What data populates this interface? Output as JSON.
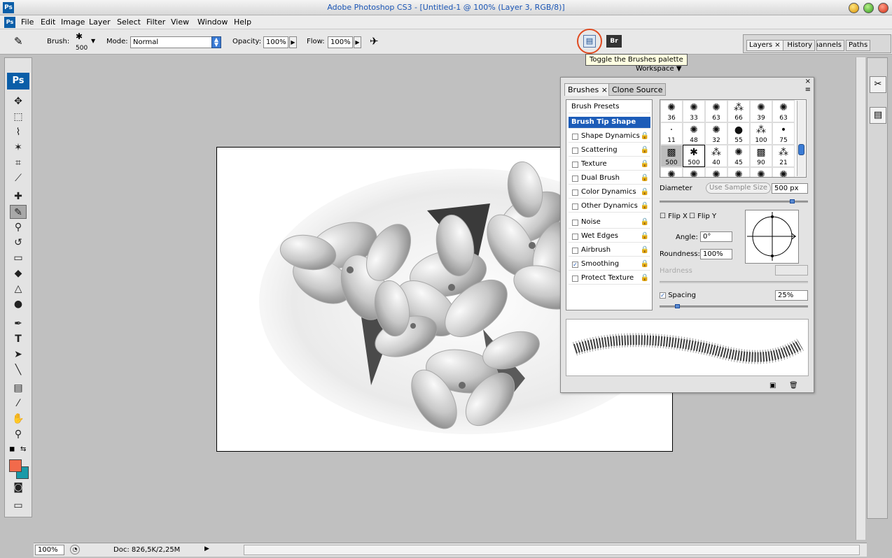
{
  "window": {
    "title": "Adobe Photoshop CS3 - [Untitled-1 @ 100% (Layer 3, RGB/8)]",
    "app_logo": "Ps"
  },
  "menu": [
    "File",
    "Edit",
    "Image",
    "Layer",
    "Select",
    "Filter",
    "View",
    "Window",
    "Help"
  ],
  "options": {
    "brush_label": "Brush:",
    "brush_size": "500",
    "mode_label": "Mode:",
    "mode_value": "Normal",
    "opacity_label": "Opacity:",
    "opacity_value": "100%",
    "flow_label": "Flow:",
    "flow_value": "100%",
    "workspace_label": "Workspace",
    "tooltip": "Toggle the Brushes palette"
  },
  "layers_dock": {
    "tabs": [
      "Layers",
      "History",
      "Channels",
      "Paths"
    ]
  },
  "toolbox": {
    "logo": "Ps",
    "fg_color": "#f26a4b",
    "bg_color": "#1a9aa8"
  },
  "brushes_palette": {
    "tabs": [
      "Brushes",
      "Clone Source"
    ],
    "header": "Brush Presets",
    "items": [
      {
        "label": "Brush Tip Shape",
        "checked": null
      },
      {
        "label": "Shape Dynamics",
        "checked": false
      },
      {
        "label": "Scattering",
        "checked": false
      },
      {
        "label": "Texture",
        "checked": false
      },
      {
        "label": "Dual Brush",
        "checked": false
      },
      {
        "label": "Color Dynamics",
        "checked": false
      },
      {
        "label": "Other Dynamics",
        "checked": false
      },
      {
        "label": "Noise",
        "checked": false
      },
      {
        "label": "Wet Edges",
        "checked": false
      },
      {
        "label": "Airbrush",
        "checked": false
      },
      {
        "label": "Smoothing",
        "checked": true
      },
      {
        "label": "Protect Texture",
        "checked": false
      }
    ],
    "presets": [
      "36",
      "33",
      "63",
      "66",
      "39",
      "63",
      "11",
      "48",
      "32",
      "55",
      "100",
      "75",
      "500",
      "500",
      "40",
      "45",
      "90",
      "21"
    ],
    "diameter_label": "Diameter",
    "use_sample_label": "Use Sample Size",
    "diameter_value": "500 px",
    "flip_x": "Flip X",
    "flip_y": "Flip Y",
    "angle_label": "Angle:",
    "angle_value": "0°",
    "roundness_label": "Roundness:",
    "roundness_value": "100%",
    "hardness_label": "Hardness",
    "spacing_label": "Spacing",
    "spacing_value": "25%"
  },
  "status": {
    "zoom": "100%",
    "doc": "Doc: 826,5K/2,25M"
  }
}
